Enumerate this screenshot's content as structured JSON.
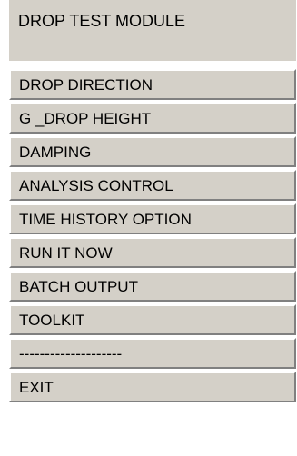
{
  "menu": {
    "title": "DROP TEST MODULE",
    "items": [
      {
        "label": "DROP DIRECTION"
      },
      {
        "label": "G _DROP HEIGHT"
      },
      {
        "label": "DAMPING"
      },
      {
        "label": "ANALYSIS CONTROL"
      },
      {
        "label": "TIME HISTORY OPTION"
      },
      {
        "label": "RUN IT NOW"
      },
      {
        "label": "BATCH OUTPUT"
      },
      {
        "label": "TOOLKIT"
      },
      {
        "label": "--------------------"
      },
      {
        "label": "EXIT"
      }
    ]
  },
  "colors": {
    "panel_background": "#d4d0c8",
    "text": "#000000",
    "highlight": "#ffffff",
    "shadow": "#808080"
  }
}
